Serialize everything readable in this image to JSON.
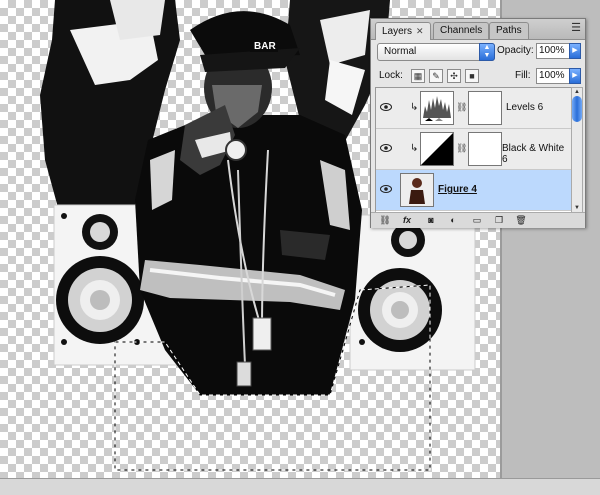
{
  "panel": {
    "tabs": [
      {
        "label": "Layers",
        "active": true
      },
      {
        "label": "Channels",
        "active": false
      },
      {
        "label": "Paths",
        "active": false
      }
    ],
    "close_glyph": "✕",
    "menu_icon": "panel-menu-icon",
    "blend_mode": "Normal",
    "opacity_label": "Opacity:",
    "opacity_value": "100%",
    "lock_label": "Lock:",
    "fill_label": "Fill:",
    "fill_value": "100%",
    "layers": [
      {
        "name": "Levels 6",
        "clipped": true,
        "visible": true,
        "selected": false,
        "type": "levels-adjustment"
      },
      {
        "name": "Black & White 6",
        "clipped": true,
        "visible": true,
        "selected": false,
        "type": "black-white-adjustment"
      },
      {
        "name": "Figure 4",
        "clipped": false,
        "visible": true,
        "selected": true,
        "type": "pixel-layer"
      }
    ],
    "bottom_icons": [
      "link-icon",
      "fx-icon",
      "mask-icon",
      "adjustment-icon",
      "folder-icon",
      "new-layer-icon",
      "trash-icon"
    ],
    "fx_label": "fx"
  },
  "artwork": {
    "cap_text": "BAR"
  },
  "colors": {
    "selection": "#bcd9fd",
    "accent": "#2a6ed8",
    "panel_bg": "#e6e6e6"
  }
}
